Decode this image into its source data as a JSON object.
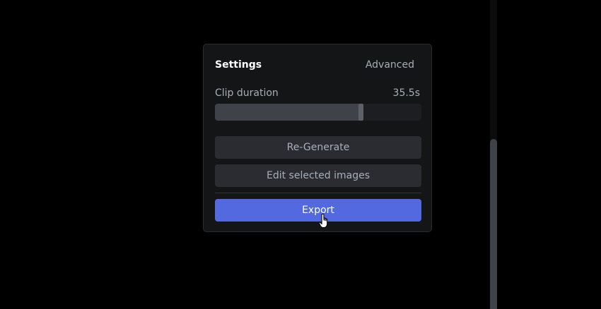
{
  "settings": {
    "title": "Settings",
    "advanced_label": "Advanced",
    "clip_duration": {
      "label": "Clip duration",
      "value_text": "35.5s",
      "slider_fraction": 0.71
    },
    "regenerate_label": "Re-Generate",
    "edit_images_label": "Edit selected images",
    "export_label": "Export"
  },
  "scrollbar": {
    "thumb_start_fraction": 0.45
  },
  "colors": {
    "background": "#000000",
    "panel": "#141517",
    "accent": "#5369e0",
    "button": "#2a2c31",
    "muted_text": "#a8aeb8"
  },
  "icons": {
    "pointer": "hand-pointer-icon"
  }
}
